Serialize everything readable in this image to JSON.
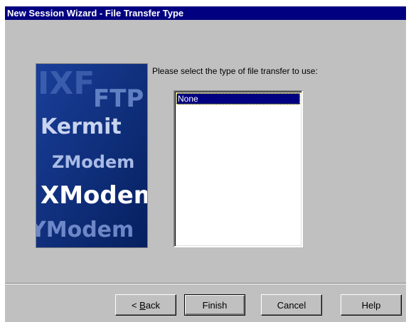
{
  "window": {
    "title": "New Session Wizard - File Transfer Type"
  },
  "art": {
    "words": [
      "IXF",
      "FTP",
      "Kermit",
      "ZModem",
      "XModem",
      "YModem"
    ]
  },
  "prompt": "Please select the type of file transfer to use:",
  "list": {
    "items": [
      "None"
    ],
    "selected": "None"
  },
  "buttons": {
    "back_prefix": "< ",
    "back_mnemonic": "B",
    "back_rest": "ack",
    "finish": "Finish",
    "cancel": "Cancel",
    "help": "Help"
  },
  "colors": {
    "titlebar": "#000080",
    "face": "#c0c0c0",
    "selection": "#000080",
    "art_bg": "#0a2a80"
  }
}
